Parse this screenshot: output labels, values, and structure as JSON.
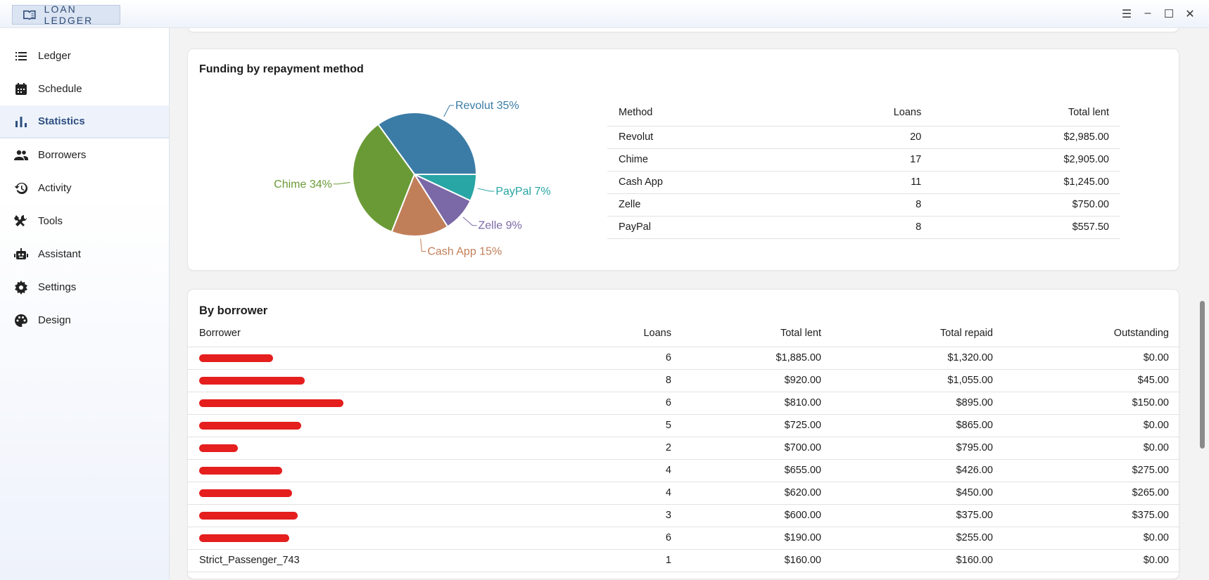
{
  "app": {
    "title": "LOAN LEDGER"
  },
  "sidebar": {
    "items": [
      {
        "label": "Ledger",
        "icon": "list-icon"
      },
      {
        "label": "Schedule",
        "icon": "calendar-icon"
      },
      {
        "label": "Statistics",
        "icon": "bar-chart-icon",
        "active": true
      },
      {
        "label": "Borrowers",
        "icon": "people-icon"
      },
      {
        "label": "Activity",
        "icon": "history-icon"
      },
      {
        "label": "Tools",
        "icon": "tools-icon"
      },
      {
        "label": "Assistant",
        "icon": "robot-icon"
      },
      {
        "label": "Settings",
        "icon": "gear-icon"
      },
      {
        "label": "Design",
        "icon": "palette-icon"
      }
    ]
  },
  "funding": {
    "title": "Funding by repayment method",
    "headers": [
      "Method",
      "Loans",
      "Total lent"
    ],
    "rows": [
      [
        "Revolut",
        "20",
        "$2,985.00"
      ],
      [
        "Chime",
        "17",
        "$2,905.00"
      ],
      [
        "Cash App",
        "11",
        "$1,245.00"
      ],
      [
        "Zelle",
        "8",
        "$750.00"
      ],
      [
        "PayPal",
        "8",
        "$557.50"
      ]
    ]
  },
  "chart_data": {
    "type": "pie",
    "title": "Funding by repayment method",
    "slices": [
      {
        "label": "Revolut",
        "value": 35,
        "text": "Revolut 35%",
        "color": "#3b7ca6"
      },
      {
        "label": "Chime",
        "value": 34,
        "text": "Chime 34%",
        "color": "#6a9a36"
      },
      {
        "label": "Cash App",
        "value": 15,
        "text": "Cash App 15%",
        "color": "#c17f59"
      },
      {
        "label": "Zelle",
        "value": 9,
        "text": "Zelle 9%",
        "color": "#7b68a6"
      },
      {
        "label": "PayPal",
        "value": 7,
        "text": "PayPal 7%",
        "color": "#28a5a5"
      }
    ]
  },
  "borrowers": {
    "title": "By borrower",
    "headers": [
      "Borrower",
      "Loans",
      "Total lent",
      "Total repaid",
      "Outstanding"
    ],
    "rows": [
      {
        "name": "",
        "redact": 105,
        "loans": "6",
        "lent": "$1,885.00",
        "repaid": "$1,320.00",
        "out": "$0.00"
      },
      {
        "name": "",
        "redact": 150,
        "loans": "8",
        "lent": "$920.00",
        "repaid": "$1,055.00",
        "out": "$45.00"
      },
      {
        "name": "",
        "redact": 205,
        "loans": "6",
        "lent": "$810.00",
        "repaid": "$895.00",
        "out": "$150.00"
      },
      {
        "name": "",
        "redact": 145,
        "loans": "5",
        "lent": "$725.00",
        "repaid": "$865.00",
        "out": "$0.00"
      },
      {
        "name": "",
        "redact": 55,
        "loans": "2",
        "lent": "$700.00",
        "repaid": "$795.00",
        "out": "$0.00"
      },
      {
        "name": "",
        "redact": 118,
        "loans": "4",
        "lent": "$655.00",
        "repaid": "$426.00",
        "out": "$275.00"
      },
      {
        "name": "",
        "redact": 132,
        "loans": "4",
        "lent": "$620.00",
        "repaid": "$450.00",
        "out": "$265.00"
      },
      {
        "name": "",
        "redact": 140,
        "loans": "3",
        "lent": "$600.00",
        "repaid": "$375.00",
        "out": "$375.00"
      },
      {
        "name": "",
        "redact": 128,
        "loans": "6",
        "lent": "$190.00",
        "repaid": "$255.00",
        "out": "$0.00"
      },
      {
        "name": "Strict_Passenger_743",
        "redact": 0,
        "loans": "1",
        "lent": "$160.00",
        "repaid": "$160.00",
        "out": "$0.00"
      }
    ]
  }
}
